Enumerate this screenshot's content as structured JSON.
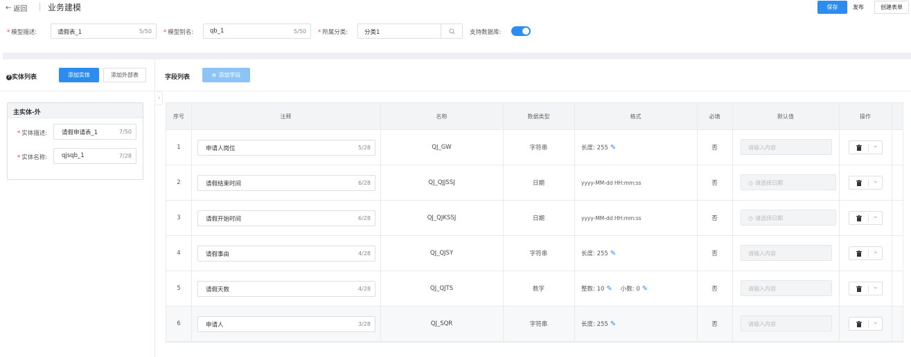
{
  "header": {
    "back_label": "返回",
    "title": "业务建模",
    "buttons": {
      "save": "保存",
      "publish": "发布",
      "create_form": "创建表单"
    }
  },
  "model_form": {
    "desc_label": "模型描述:",
    "desc_value": "请假表_1",
    "desc_count": "5/50",
    "alias_label": "模型别名:",
    "alias_value": "qb_1",
    "alias_count": "5/50",
    "category_label": "所属分类:",
    "category_value": "分类1",
    "db_support_label": "支持数据库:",
    "db_support_on": true
  },
  "entity_panel": {
    "title": "实体列表",
    "add_entity": "添加实体",
    "add_external": "添加外部表",
    "card_title": "主实体-外",
    "desc_label": "实体描述:",
    "desc_value": "请假申请表_1",
    "desc_count": "7/50",
    "name_label": "实体名称:",
    "name_value": "qjsqb_1",
    "name_count": "7/28"
  },
  "field_panel": {
    "title": "字段列表",
    "add_field": "添加字段"
  },
  "table": {
    "headers": [
      "序号",
      "注释",
      "名称",
      "数据类型",
      "格式",
      "必填",
      "默认值",
      "操作"
    ],
    "rows": [
      {
        "no": "1",
        "note": "申请人岗位",
        "count": "5/28",
        "name": "QJ_GW",
        "type": "字符串",
        "format": "长度: 255",
        "required": "否",
        "default": "请输入内容",
        "default_kind": "input"
      },
      {
        "no": "2",
        "note": "请假结束时间",
        "count": "6/28",
        "name": "QJ_QJJSSJ",
        "type": "日期",
        "format": "yyyy-MM-dd HH:mm:ss",
        "required": "否",
        "default": "请选择日期",
        "default_kind": "date"
      },
      {
        "no": "3",
        "note": "请假开始时间",
        "count": "6/28",
        "name": "QJ_QJKSSJ",
        "type": "日期",
        "format": "yyyy-MM-dd HH:mm:ss",
        "required": "否",
        "default": "请选择日期",
        "default_kind": "date"
      },
      {
        "no": "4",
        "note": "请假事由",
        "count": "4/28",
        "name": "QJ_QJSY",
        "type": "字符串",
        "format": "长度: 255",
        "required": "否",
        "default": "请输入内容",
        "default_kind": "input"
      },
      {
        "no": "5",
        "note": "请假天数",
        "count": "4/28",
        "name": "QJ_QJTS",
        "type": "数字",
        "format": "整数: 10",
        "format2": "小数: 0",
        "required": "否",
        "default": "请输入内容",
        "default_kind": "input"
      },
      {
        "no": "6",
        "note": "申请人",
        "count": "3/28",
        "name": "QJ_SQR",
        "type": "字符串",
        "format": "长度: 255",
        "required": "否",
        "default": "请输入内容",
        "default_kind": "input"
      }
    ]
  },
  "colors": {
    "primary": "#2d8cf0",
    "required_star": "#f04134",
    "disabled_btn": "#8cc4f7"
  }
}
